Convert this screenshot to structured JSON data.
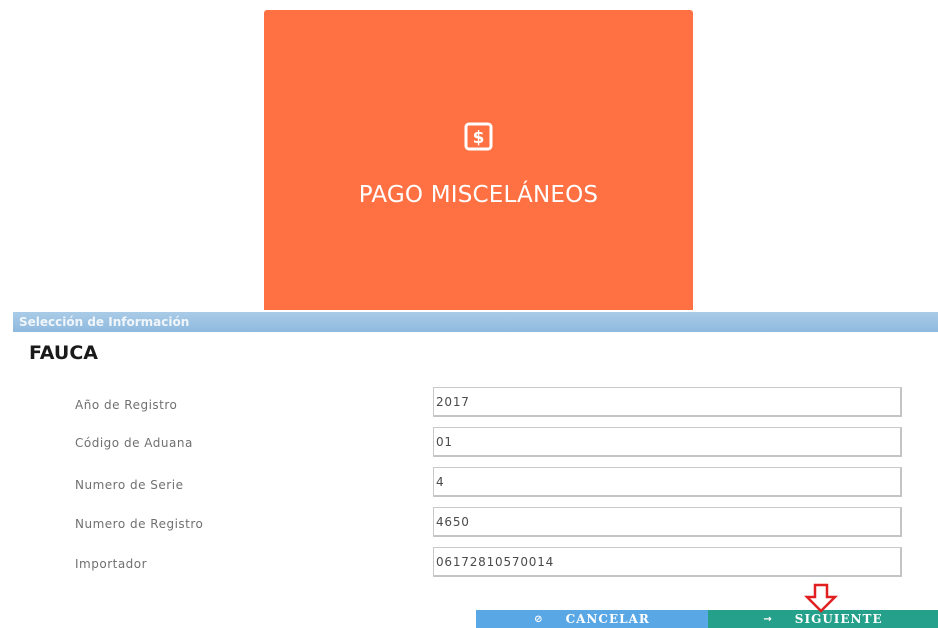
{
  "tile": {
    "label": "PAGO MISCELÁNEOS",
    "icon": "dollar-icon",
    "color": "#ff7043"
  },
  "panel": {
    "header": "Selección de Información",
    "title": "FAUCA",
    "header_color": "#9cc3e3",
    "fields": [
      {
        "label": "Año de Registro",
        "value": "2017"
      },
      {
        "label": "Código de Aduana",
        "value": "01"
      },
      {
        "label": "Numero de Serie",
        "value": "4"
      },
      {
        "label": "Numero de Registro",
        "value": "4650"
      },
      {
        "label": "Importador",
        "value": "06172810570014"
      }
    ]
  },
  "buttons": {
    "cancel_label": "CANCELAR",
    "cancel_icon": "cancel-icon",
    "cancel_color": "#5aa7e6",
    "next_label": "SIGUIENTE",
    "next_icon": "arrow-right-icon",
    "next_color": "#25a08a"
  },
  "annotation": {
    "icon": "red-down-arrow-icon",
    "color": "#e02020"
  }
}
